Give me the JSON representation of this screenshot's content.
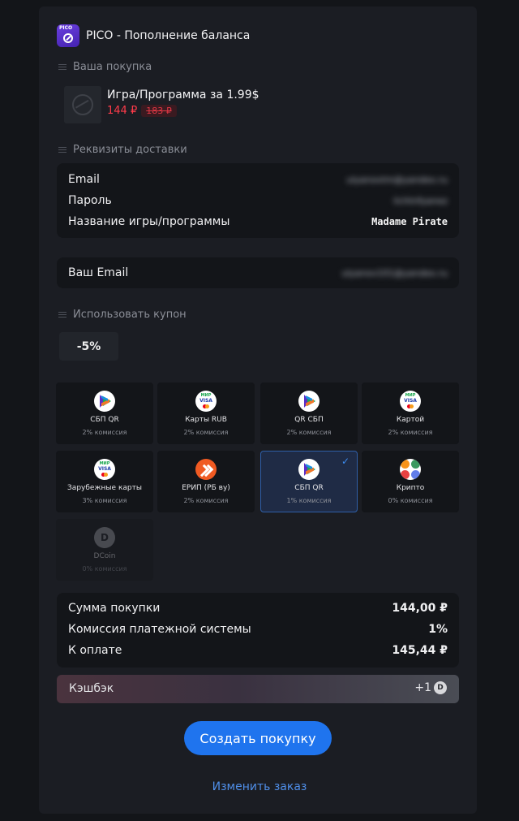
{
  "header": {
    "logo_text": "PICO",
    "title": "PICO - Пополнение баланса"
  },
  "purchase": {
    "section_label": "Ваша покупка",
    "product_title": "Игра/Программа за 1.99$",
    "price_new": "144 ₽",
    "price_old": "183 ₽"
  },
  "delivery": {
    "section_label": "Реквизиты доставки",
    "rows": [
      {
        "label": "Email",
        "value": "ulyanovtm@yandex.ru"
      },
      {
        "label": "Пароль",
        "value": "lichtnfyanez"
      },
      {
        "label": "Название игры/программы",
        "value": "Madame Pirate"
      }
    ]
  },
  "your_email": {
    "label": "Ваш Email",
    "value": "ulyanov101@yandex.ru"
  },
  "coupon": {
    "section_label": "Использовать купон",
    "value": "-5%"
  },
  "payment_methods": [
    {
      "name": "СБП QR",
      "fee": "2% комиссия",
      "icon": "sbp-icon"
    },
    {
      "name": "Карты RUB",
      "fee": "2% комиссия",
      "icon": "mir-visa-icon"
    },
    {
      "name": "QR СБП",
      "fee": "2% комиссия",
      "icon": "sbp-icon"
    },
    {
      "name": "Картой",
      "fee": "2% комиссия",
      "icon": "mir-visa-icon"
    },
    {
      "name": "Зарубежные карты",
      "fee": "3% комиссия",
      "icon": "mir-visa-icon"
    },
    {
      "name": "ЕРИП (РБ ву)",
      "fee": "2% комиссия",
      "icon": "erip-icon"
    },
    {
      "name": "СБП QR",
      "fee": "1% комиссия",
      "icon": "sbp-icon",
      "selected": true
    },
    {
      "name": "Крипто",
      "fee": "0% комиссия",
      "icon": "crypto-icon"
    },
    {
      "name": "DCoin",
      "fee": "0% комиссия",
      "icon": "dcoin-icon",
      "disabled": true
    }
  ],
  "totals": {
    "rows": [
      {
        "label": "Сумма покупки",
        "value": "144,00 ₽"
      },
      {
        "label": "Комиссия платежной системы",
        "value": "1%"
      },
      {
        "label": "К оплате",
        "value": "145,44 ₽"
      }
    ]
  },
  "cashback": {
    "label": "Кэшбэк",
    "value": "+1",
    "coin_letter": "D"
  },
  "actions": {
    "create_label": "Создать покупку",
    "change_label": "Изменить заказ"
  },
  "colors": {
    "accent": "#1f74ee",
    "price_red": "#ff3b4a",
    "link": "#4f8ee8"
  }
}
